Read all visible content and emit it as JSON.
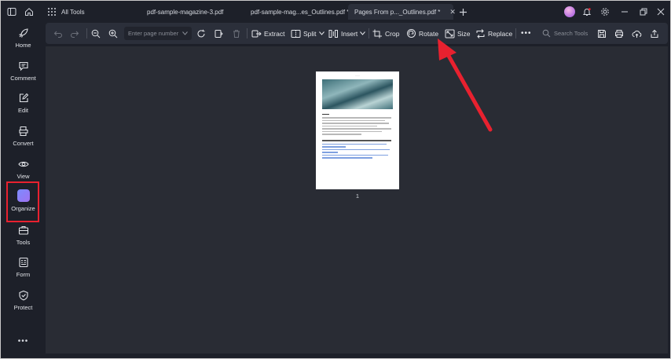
{
  "titlebar": {
    "all_tools": "All Tools",
    "tabs": [
      {
        "label": "pdf-sample-magazine-3.pdf"
      },
      {
        "label": "pdf-sample-mag...es_Outlines.pdf *"
      },
      {
        "label": "Pages From p..._Outlines.pdf *"
      }
    ]
  },
  "sidebar": {
    "items": [
      {
        "label": "Home",
        "icon": "rocket-icon"
      },
      {
        "label": "Comment",
        "icon": "comment-icon"
      },
      {
        "label": "Edit",
        "icon": "edit-icon"
      },
      {
        "label": "Convert",
        "icon": "convert-icon"
      },
      {
        "label": "View",
        "icon": "eye-icon"
      },
      {
        "label": "Organize",
        "icon": "organize-icon"
      },
      {
        "label": "Tools",
        "icon": "toolbox-icon"
      },
      {
        "label": "Form",
        "icon": "form-icon"
      },
      {
        "label": "Protect",
        "icon": "shield-icon"
      }
    ],
    "more": "•••"
  },
  "toolbar": {
    "page_placeholder": "Enter page number",
    "extract": "Extract",
    "split": "Split",
    "insert": "Insert",
    "crop": "Crop",
    "rotate": "Rotate",
    "size": "Size",
    "replace": "Replace",
    "more": "•••",
    "search_tools": "Search Tools"
  },
  "canvas": {
    "page_number": "1"
  },
  "colors": {
    "highlight": "#e8212f",
    "background": "#1d2029",
    "toolbar": "#2b2f3a",
    "canvas": "#292c34"
  }
}
